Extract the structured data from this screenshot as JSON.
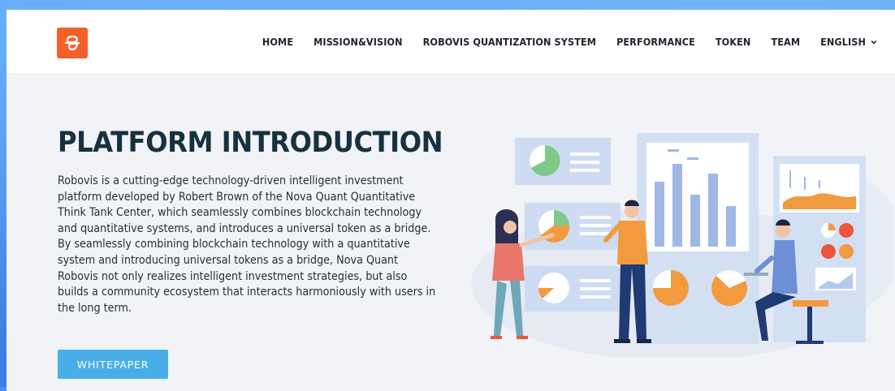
{
  "nav": {
    "items": [
      "HOME",
      "MISSION&VISION",
      "ROBOVIS QUANTIZATION SYSTEM",
      "PERFORMANCE",
      "TOKEN",
      "TEAM"
    ],
    "language": "ENGLISH"
  },
  "hero": {
    "title": "PLATFORM INTRODUCTION",
    "description": "Robovis is a cutting-edge technology-driven intelligent investment platform developed by Robert Brown of the Nova Quant Quantitative Think Tank Center, which seamlessly combines blockchain technology and quantitative systems, and introduces a universal token as a bridge. By seamlessly combining blockchain technology with a quantitative system and introducing universal tokens as a bridge, Nova Quant Robovis not only realizes intelligent investment strategies, but also builds a community ecosystem that interacts harmoniously with users in the long term.",
    "button_label": "WHITEPAPER"
  },
  "colors": {
    "brand_orange": "#f4602a",
    "button_blue": "#49aee8",
    "title_navy": "#17313f",
    "background_blue": "#4d8ff2"
  },
  "icons": {
    "logo": "brand-logo-icon",
    "language_chevron": "chevron-down-icon",
    "illustration": "data-analytics-team-illustration"
  }
}
